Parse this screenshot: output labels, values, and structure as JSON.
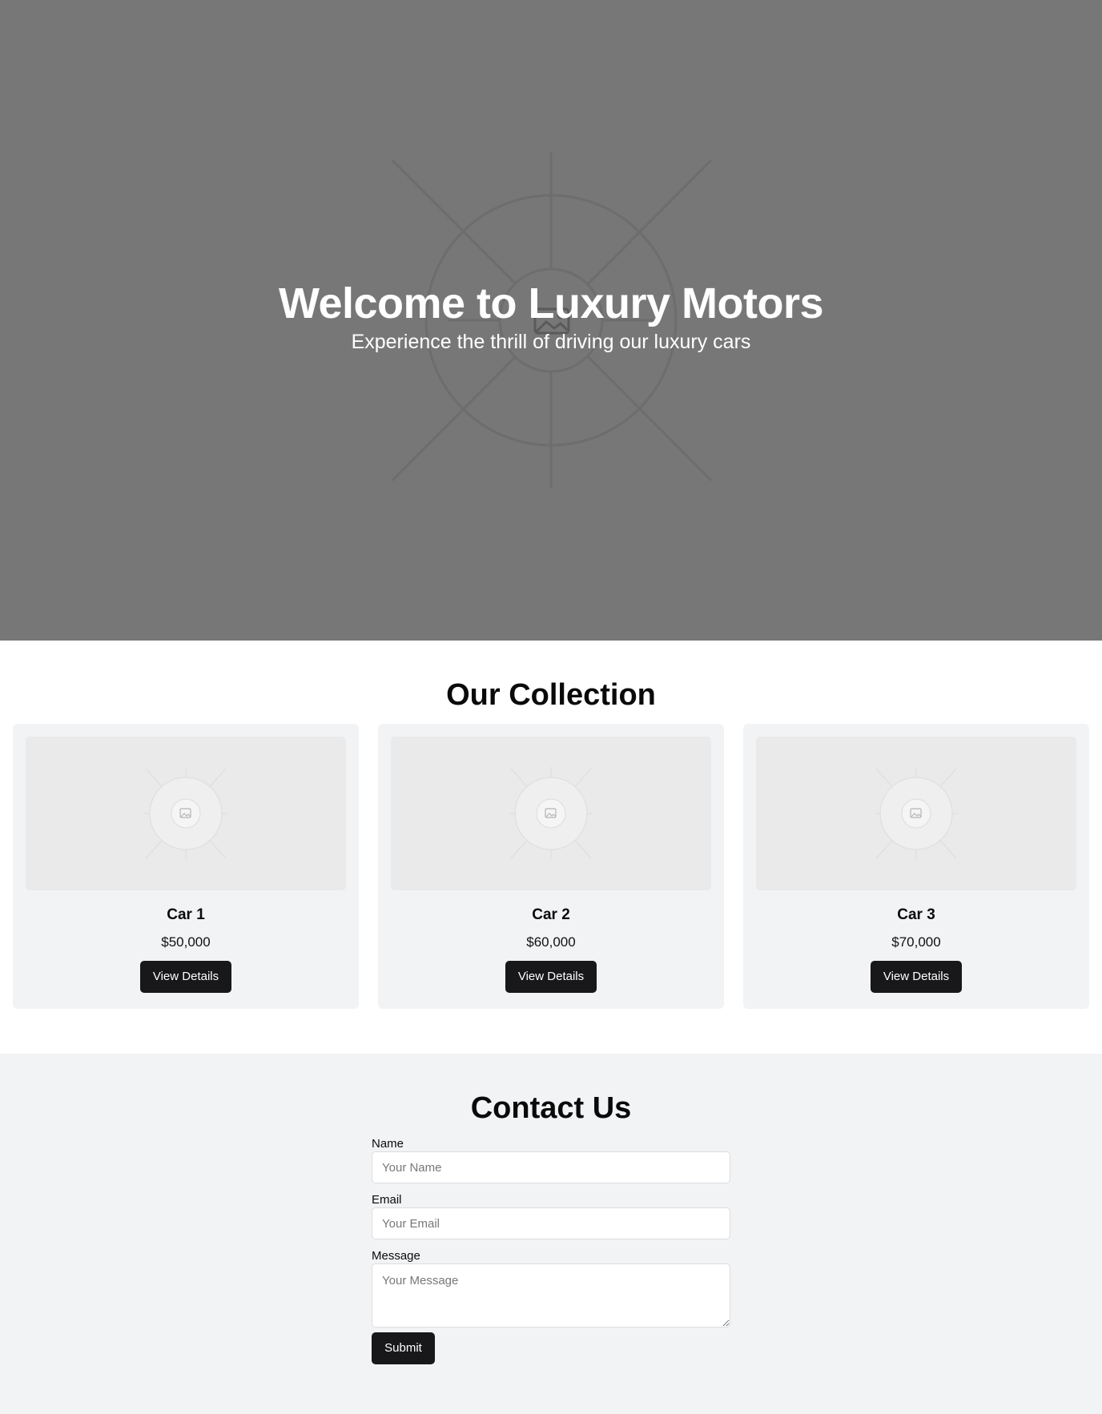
{
  "hero": {
    "title": "Welcome to Luxury Motors",
    "subtitle": "Experience the thrill of driving our luxury cars",
    "background_color": "#777777"
  },
  "collection": {
    "title": "Our Collection",
    "cars": [
      {
        "name": "Car 1",
        "price": "$50,000",
        "button_label": "View Details"
      },
      {
        "name": "Car 2",
        "price": "$60,000",
        "button_label": "View Details"
      },
      {
        "name": "Car 3",
        "price": "$70,000",
        "button_label": "View Details"
      }
    ]
  },
  "contact": {
    "title": "Contact Us",
    "name_label": "Name",
    "name_placeholder": "Your Name",
    "email_label": "Email",
    "email_placeholder": "Your Email",
    "message_label": "Message",
    "message_placeholder": "Your Message",
    "submit_label": "Submit"
  },
  "colors": {
    "button": "#18181b",
    "card_background": "#f2f3f5",
    "placeholder_image": "#eaeaea"
  },
  "icons": {
    "hero_image": "image-placeholder-icon",
    "card_image": "image-placeholder-icon"
  }
}
